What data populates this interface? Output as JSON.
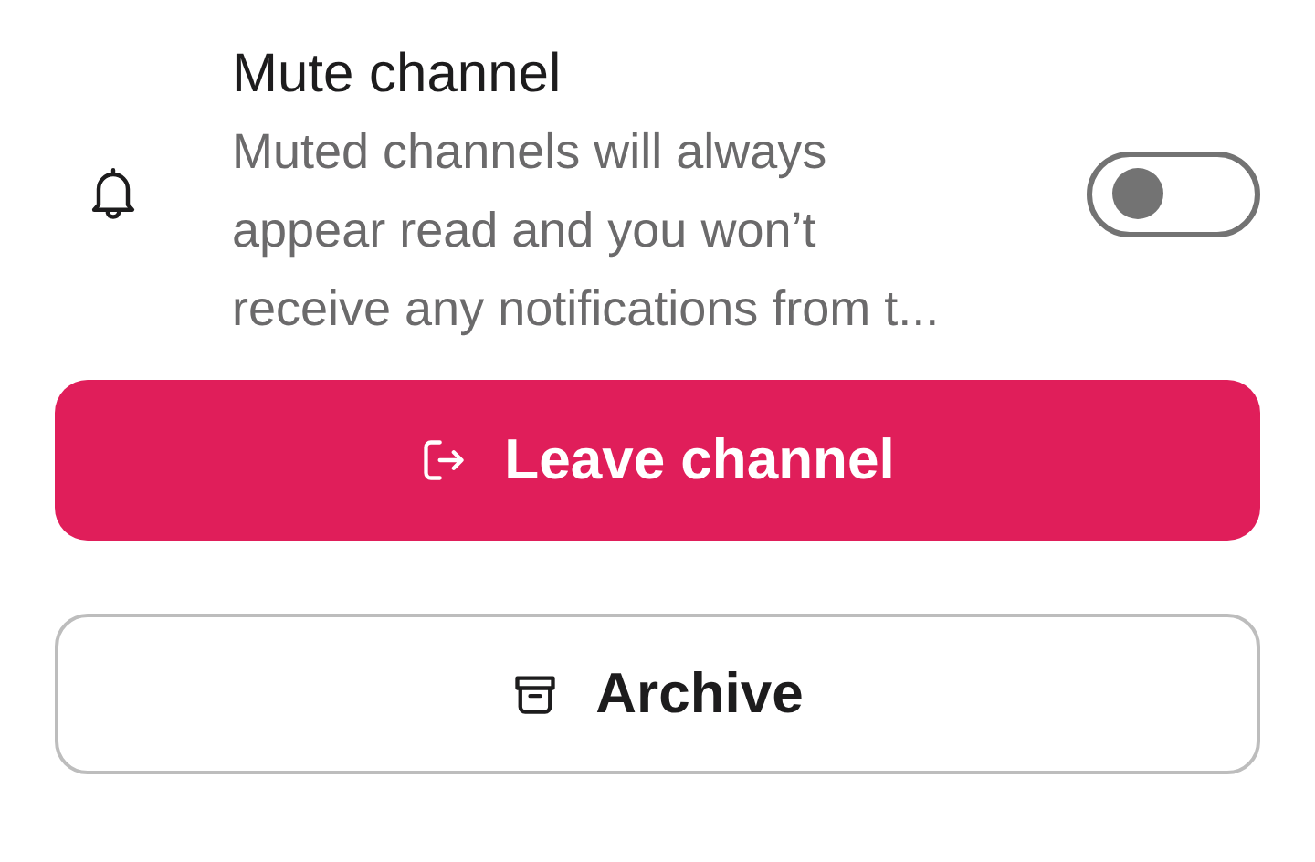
{
  "mute_setting": {
    "title": "Mute channel",
    "description": "Muted channels will always appear read and you won’t receive any notifications from t...",
    "on": false
  },
  "buttons": [
    {
      "label": "Leave channel",
      "kind": "primary"
    },
    {
      "label": "Archive",
      "kind": "secondary"
    }
  ]
}
